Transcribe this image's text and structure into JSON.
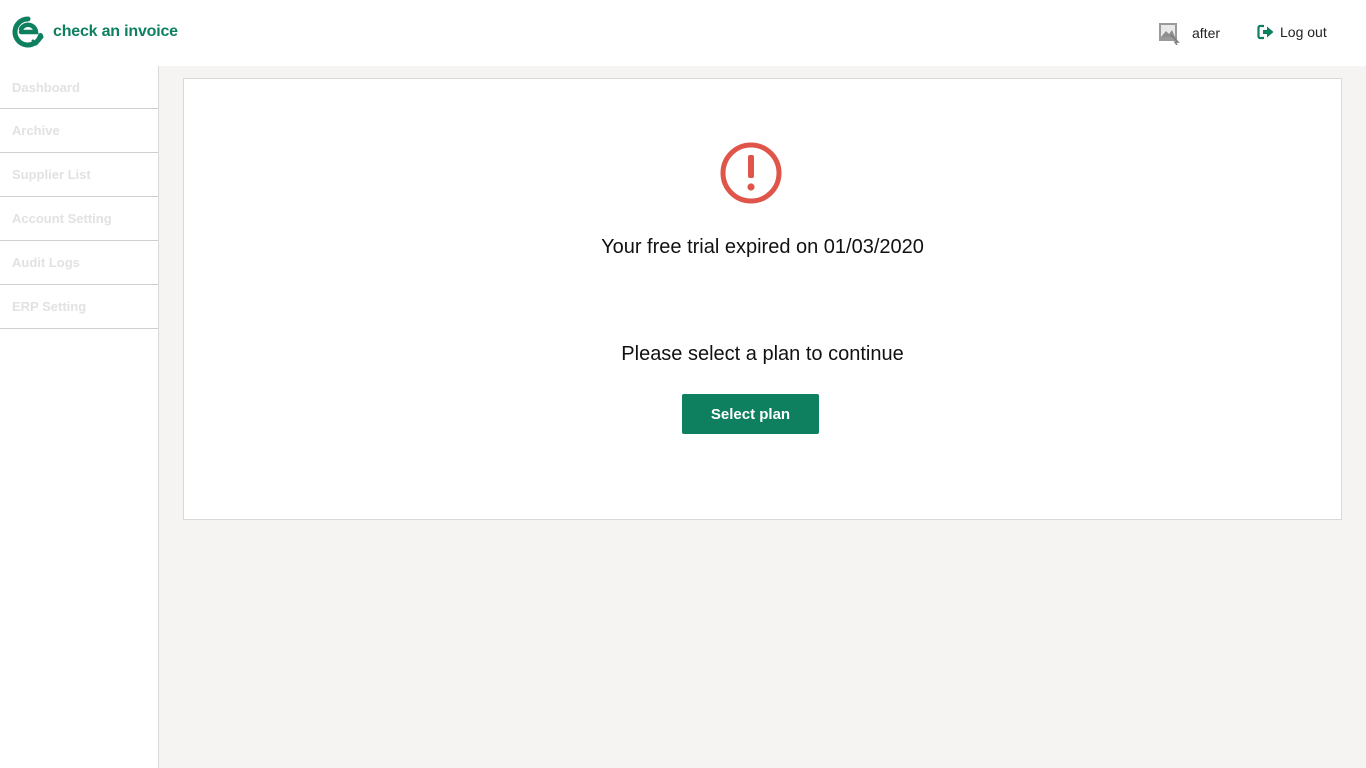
{
  "app": {
    "brand_name": "check an invoice",
    "brand_color": "#0e8060"
  },
  "header": {
    "user_name": "after",
    "avatar_icon": "broken-image-icon",
    "logout_label": "Log out",
    "logout_icon": "sign-out-icon"
  },
  "sidebar": {
    "items": [
      {
        "label": "Dashboard"
      },
      {
        "label": "Archive"
      },
      {
        "label": "Supplier List"
      },
      {
        "label": "Account Setting"
      },
      {
        "label": "Audit Logs"
      },
      {
        "label": "ERP Setting"
      }
    ]
  },
  "main": {
    "alert_icon": "exclamation-circle-icon",
    "alert_color": "#e0554a",
    "expired_message": "Your free trial expired on 01/03/2020",
    "prompt": "Please select a plan to continue",
    "select_plan_label": "Select plan"
  }
}
